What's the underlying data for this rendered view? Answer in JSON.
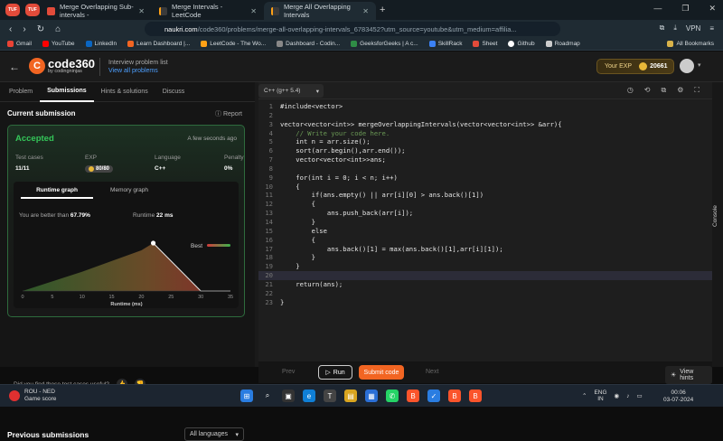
{
  "browser": {
    "tabs": [
      {
        "label": "Merge Overlapping Sub-intervals - ",
        "active": false
      },
      {
        "label": "Merge Intervals - LeetCode",
        "active": false
      },
      {
        "label": "Merge All Overlapping Intervals",
        "active": true
      }
    ],
    "new_tab": "+",
    "url_host": "naukri.com",
    "url_rest": "/code360/problems/merge-all-overlapping-intervals_6783452?utm_source=youtube&utm_medium=affilia...",
    "vpn": "VPN",
    "bookmarks": [
      {
        "label": "Gmail",
        "color": "#ea4335"
      },
      {
        "label": "YouTube",
        "color": "#ff0000"
      },
      {
        "label": "LinkedIn",
        "color": "#0a66c2"
      },
      {
        "label": "Learn Dashboard |...",
        "color": "#f26522"
      },
      {
        "label": "LeetCode - The Wo...",
        "color": "#ffa116"
      },
      {
        "label": "Dashboard - Codin...",
        "color": "#888888"
      },
      {
        "label": "GeeksforGeeks | A c...",
        "color": "#2f8d46"
      },
      {
        "label": "SkillRack",
        "color": "#3b82f6"
      },
      {
        "label": "Sheet",
        "color": "#e24b3a"
      },
      {
        "label": "Github",
        "color": "#ffffff"
      },
      {
        "label": "Roadmap",
        "color": "#cccccc"
      }
    ],
    "all_bookmarks": "All Bookmarks"
  },
  "header": {
    "logo_text": "code",
    "logo_num": "360",
    "logo_sub": "by codingninjas",
    "problem_list_label": "Interview problem list",
    "view_all": "View all problems",
    "your_exp": "Your EXP",
    "exp_value": "20661"
  },
  "left": {
    "tabs": [
      "Problem",
      "Submissions",
      "Hints & solutions",
      "Discuss"
    ],
    "current_submission": "Current submission",
    "report": "Report",
    "status": "Accepted",
    "time_ago": "A few seconds ago",
    "stats": {
      "test_cases_label": "Test cases",
      "test_cases_value": "11/11",
      "exp_label": "EXP",
      "exp_value": "80/80",
      "language_label": "Language",
      "language_value": "C++",
      "penalty_label": "Penalty",
      "penalty_value": "0%"
    },
    "graph_tabs": [
      "Runtime graph",
      "Memory graph"
    ],
    "better_than_label": "You are better than",
    "better_than_value": "67.79%",
    "runtime_label": "Runtime",
    "runtime_value": "22 ms",
    "best_label": "Best",
    "feedback": "Did you find these test cases useful?",
    "previous_submissions": "Previous submissions",
    "all_languages": "All languages"
  },
  "chart_data": {
    "type": "area",
    "x": [
      0,
      10,
      20,
      22,
      30,
      35
    ],
    "y": [
      0,
      0.4,
      0.85,
      1.0,
      0.0,
      0.0
    ],
    "marker_x": 22,
    "xlabel": "Runtime (ms)",
    "ylabel": "",
    "xlim": [
      0,
      35
    ],
    "xticks": [
      0,
      5,
      10,
      15,
      20,
      25,
      30,
      35
    ],
    "grid": false
  },
  "editor": {
    "language": "C++ (g++ 5.4)",
    "lines": [
      "#include<vector>",
      "",
      "vector<vector<int>> mergeOverlappingIntervals(vector<vector<int>> &arr){",
      "    // Write your code here.",
      "    int n = arr.size();",
      "    sort(arr.begin(),arr.end());",
      "    vector<vector<int>>ans;",
      "",
      "    for(int i = 0; i < n; i++)",
      "    {",
      "        if(ans.empty() || arr[i][0] > ans.back()[1])",
      "        {",
      "            ans.push_back(arr[i]);",
      "        }",
      "        else",
      "        {",
      "            ans.back()[1] = max(ans.back()[1],arr[i][1]);",
      "        }",
      "    }",
      "",
      "    return(ans);",
      "",
      "}"
    ],
    "highlight_line": 20,
    "console": "Console"
  },
  "bottom": {
    "prev": "Prev",
    "run": "Run",
    "submit": "Submit code",
    "next": "Next",
    "view_hints": "View hints"
  },
  "taskbar": {
    "weather_title": "ROU - NED",
    "weather_sub": "Game score",
    "lang_top": "ENG",
    "lang_bottom": "IN",
    "time": "00:06",
    "date": "03-07-2024"
  }
}
